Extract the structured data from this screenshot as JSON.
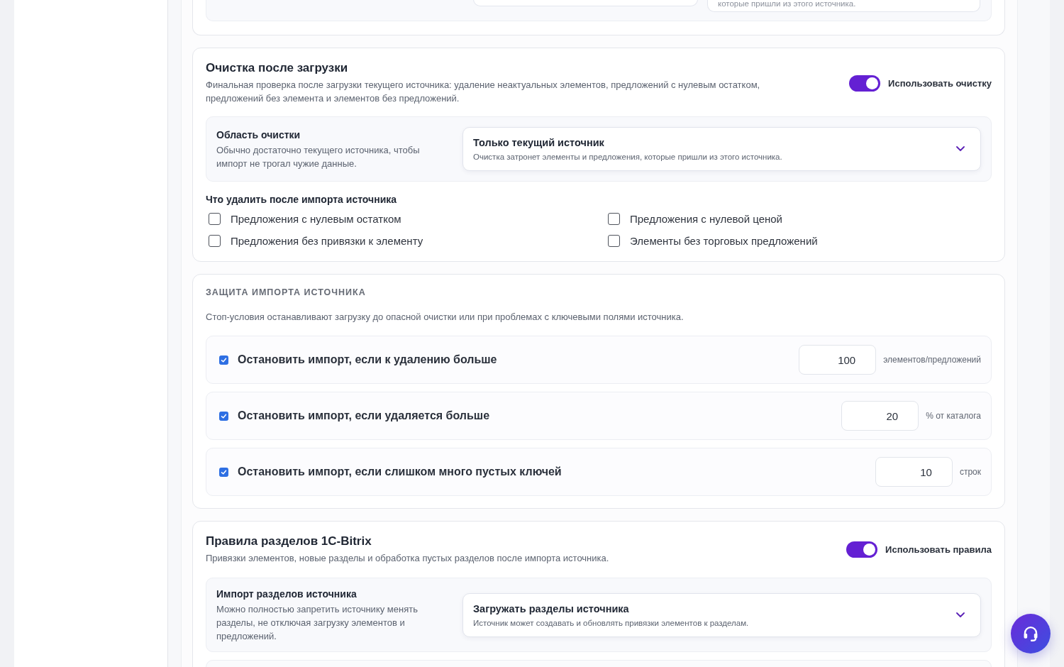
{
  "previous_section": {
    "select_description": "которые пришли из этого источника."
  },
  "cleanup": {
    "title": "Очистка после загрузки",
    "description": "Финальная проверка после загрузки текущего источника: удаление неактуальных элементов, предложений с нулевым остатком, предложений без элемента и элементов без предложений.",
    "toggle": {
      "label": "Использовать очистку",
      "on": true
    },
    "scope": {
      "title": "Область очистки",
      "description": "Обычно достаточно текущего источника, чтобы импорт не трогал чужие данные.",
      "select": {
        "value": "Только текущий источник",
        "description": "Очистка затронет элементы и предложения, которые пришли из этого источника."
      }
    },
    "options_heading": "Что удалить после импорта источника",
    "options": [
      {
        "label": "Предложения с нулевым остатком",
        "checked": false
      },
      {
        "label": "Предложения с нулевой ценой",
        "checked": false
      },
      {
        "label": "Предложения без привязки к элементу",
        "checked": false
      },
      {
        "label": "Элементы без торговых предложений",
        "checked": false
      }
    ]
  },
  "protection": {
    "heading": "ЗАЩИТА ИМПОРТА ИСТОЧНИКА",
    "description": "Стоп-условия останавливают загрузку до опасной очистки или при проблемах с ключевыми полями источника.",
    "rules": [
      {
        "label": "Остановить импорт, если к удалению больше",
        "checked": true,
        "value": "100",
        "unit": "элементов/предложений"
      },
      {
        "label": "Остановить импорт, если удаляется больше",
        "checked": true,
        "value": "20",
        "unit": "% от каталога"
      },
      {
        "label": "Остановить импорт, если слишком много пустых ключей",
        "checked": true,
        "value": "10",
        "unit": "строк"
      }
    ]
  },
  "section_rules": {
    "title": "Правила разделов 1C-Bitrix",
    "description": "Привязки элементов, новые разделы и обработка пустых разделов после импорта источника.",
    "toggle": {
      "label": "Использовать правила",
      "on": true
    },
    "section_import": {
      "title": "Импорт разделов источника",
      "description": "Можно полностью запретить источнику менять разделы, не отключая загрузку элементов и предложений.",
      "select": {
        "value": "Загружать разделы источника",
        "description": "Источник может создавать и обновлять привязки элементов к разделам."
      }
    }
  }
}
